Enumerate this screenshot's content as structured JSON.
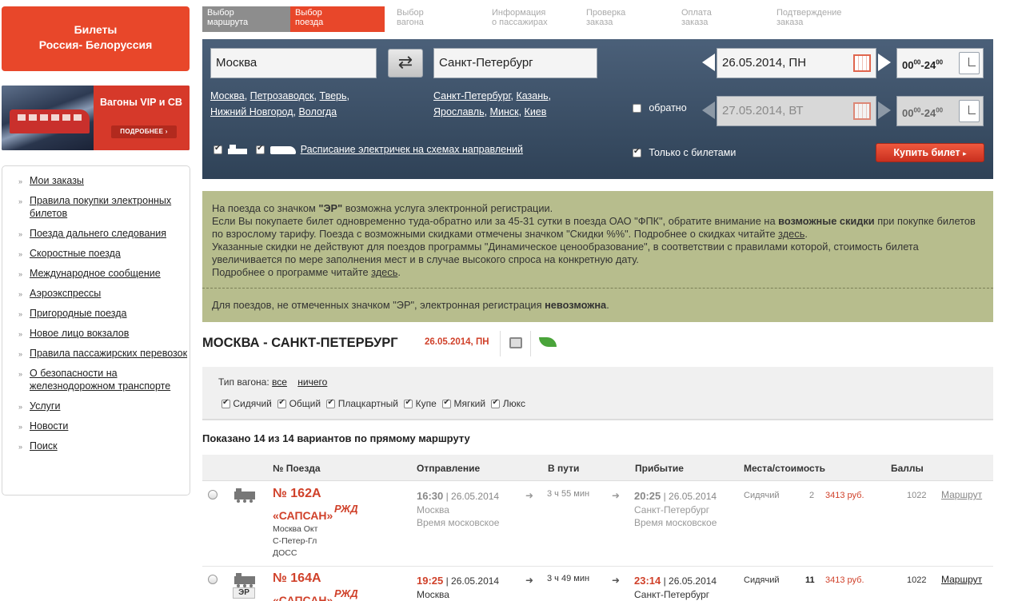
{
  "promo": {
    "title_line1": "Билеты",
    "title_line2": "Россия- Белоруссия",
    "vip_title": "Вагоны VIP и СВ",
    "vip_more": "ПОДРОБНЕЕ"
  },
  "sidebar": {
    "items": [
      {
        "label": "Мои заказы"
      },
      {
        "label": "Правила покупки электронных билетов"
      },
      {
        "label": "Поезда дальнего следования"
      },
      {
        "label": "Скоростные поезда"
      },
      {
        "label": "Международное сообщение"
      },
      {
        "label": "Аэроэкспрессы"
      },
      {
        "label": "Пригородные поезда"
      },
      {
        "label": "Новое лицо вокзалов"
      },
      {
        "label": "Правила пассажирских перевозок"
      },
      {
        "label": "О безопасности на железнодорожном транспорте"
      },
      {
        "label": "Услуги"
      },
      {
        "label": "Новости"
      },
      {
        "label": "Поиск"
      }
    ]
  },
  "steps": [
    {
      "l1": "Выбор",
      "l2": "маршрута"
    },
    {
      "l1": "Выбор",
      "l2": "поезда"
    },
    {
      "l1": "Выбор",
      "l2": "вагона"
    },
    {
      "l1": "Информация",
      "l2": "о пассажирах"
    },
    {
      "l1": "Проверка",
      "l2": "заказа"
    },
    {
      "l1": "Оплата",
      "l2": "заказа"
    },
    {
      "l1": "Подтверждение",
      "l2": "заказа"
    }
  ],
  "search": {
    "from": "Москва",
    "to": "Санкт-Петербург",
    "from_quick": [
      "Москва",
      "Петрозаводск",
      "Тверь",
      "Нижний Новгород",
      "Вологда"
    ],
    "to_quick": [
      "Санкт-Петербург",
      "Казань",
      "Ярославль",
      "Минск",
      "Киев"
    ],
    "date_there": "26.05.2014, ПН",
    "date_back": "27.05.2014, ВТ",
    "time_from": "00",
    "time_from_sup": "00",
    "time_to": "24",
    "time_to_sup": "00",
    "back_label": "обратно",
    "schedule_link": "Расписание электричек на схемах направлений",
    "only_tickets": "Только с билетами",
    "buy_button": "Купить билет"
  },
  "info": {
    "l1a": "На поезда со значком ",
    "l1b": "\"ЭР\"",
    "l1c": " возможна услуга электронной регистрации.",
    "l2a": "Если Вы покупаете билет одновременно туда-обратно или за 45-31 сутки в поезда ОАО \"ФПК\", обратите внимание на ",
    "l2b": "возможные скидки",
    "l2c": " при покупке билетов по взрослому тарифу. Поезда с возможными скидками отмечены значком \"Скидки %%\". Подробнее о скидках читайте ",
    "l2d": "здесь",
    "l2e": ".",
    "l3": "Указанные скидки не действуют для поездов программы \"Динамическое ценообразование\", в соответствии с правилами которой, стоимость билета увеличивается по мере заполнения мест и в случае высокого спроса на конкретную дату.",
    "l4a": "Подробнее о программе читайте ",
    "l4b": "здесь",
    "l4c": ".",
    "l5a": "Для поездов, не отмеченных значком \"ЭР\", электронная регистрация ",
    "l5b": "невозможна",
    "l5c": "."
  },
  "route": {
    "title": "МОСКВА - САНКТ-ПЕТЕРБУРГ",
    "date": "26.05.2014, ПН"
  },
  "filter": {
    "label": "Тип вагона:",
    "all": "все",
    "none": "ничего",
    "types": [
      "Сидячий",
      "Общий",
      "Плацкартный",
      "Купе",
      "Мягкий",
      "Люкс"
    ]
  },
  "shown": "Показано 14 из 14 вариантов по прямому маршруту",
  "table": {
    "headers": {
      "num": "№ Поезда",
      "dep": "Отправление",
      "way": "В пути",
      "arr": "Прибытие",
      "seats": "Места/стоимость",
      "score": "Баллы"
    },
    "rows": [
      {
        "num": "№ 162А",
        "name": "«САПСАН»",
        "rzd": "РЖД",
        "st1": "Москва Окт",
        "st2": "С-Петер-Гл",
        "st3": "ДОСС",
        "dep_time": "16:30",
        "dep_date": "| 26.05.2014",
        "dep_city": "Москва",
        "dep_tz": "Время московское",
        "way": "3 ч 55 мин",
        "arr_time": "20:25",
        "arr_date": "| 26.05.2014",
        "arr_city": "Санкт-Петербург",
        "arr_tz": "Время московское",
        "seat_type": "Сидячий",
        "seat_count": "2",
        "price": "3413 руб.",
        "score": "1022",
        "route_link": "Маршрут"
      },
      {
        "num": "№ 164А",
        "name": "«САПСАН»",
        "rzd": "РЖД",
        "er": "ЭР",
        "dep_time": "19:25",
        "dep_date": "| 26.05.2014",
        "dep_city": "Москва",
        "way": "3 ч 49 мин",
        "arr_time": "23:14",
        "arr_date": "| 26.05.2014",
        "arr_city": "Санкт-Петербург",
        "seat_type": "Сидячий",
        "seat_count": "11",
        "price": "3413 руб.",
        "score": "1022",
        "route_link": "Маршрут"
      }
    ]
  }
}
